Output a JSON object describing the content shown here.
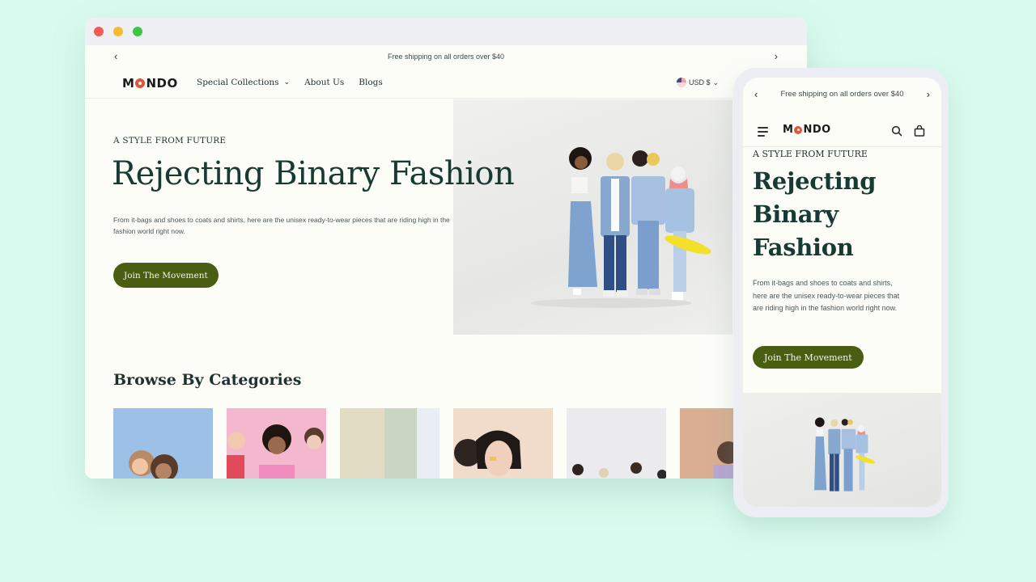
{
  "colors": {
    "background": "#d9fbef",
    "accent": "#4a5e12",
    "heading": "#173a33",
    "logo_dot": "#e2553e"
  },
  "desktop": {
    "announcement": "Free shipping on all orders over $40",
    "logo": {
      "prefix": "M",
      "suffix": "NDO"
    },
    "nav": [
      {
        "label": "Special Collections",
        "has_dropdown": true
      },
      {
        "label": "About Us",
        "has_dropdown": false
      },
      {
        "label": "Blogs",
        "has_dropdown": false
      }
    ],
    "currency": "USD $",
    "hero": {
      "eyebrow": "A STYLE FROM FUTURE",
      "title": "Rejecting Binary Fashion",
      "description": "From it-bags and shoes to coats and shirts, here are the unisex ready-to-wear pieces that are riding high in the fashion world right now.",
      "cta": "Join The Movement"
    },
    "browse": {
      "title": "Browse By Categories",
      "categories": [
        {
          "name": "category-1",
          "bg": "#9cc0e6"
        },
        {
          "name": "category-2",
          "bg": "#f3b8cd"
        },
        {
          "name": "category-3",
          "bg": "#e8e6d8"
        },
        {
          "name": "category-4",
          "bg": "#f1dccb"
        },
        {
          "name": "category-5",
          "bg": "#eaeaec"
        },
        {
          "name": "category-6",
          "bg": "#d9ae92"
        }
      ]
    }
  },
  "mobile": {
    "announcement": "Free shipping on all orders over $40",
    "logo": {
      "prefix": "M",
      "suffix": "NDO"
    },
    "hero": {
      "eyebrow": "A STYLE FROM FUTURE",
      "title_lines": [
        "Rejecting",
        "Binary",
        "Fashion"
      ],
      "description": "From it-bags and shoes to coats and shirts, here are the unisex ready-to-wear pieces that are riding high in the fashion world right now.",
      "cta": "Join The Movement"
    }
  }
}
